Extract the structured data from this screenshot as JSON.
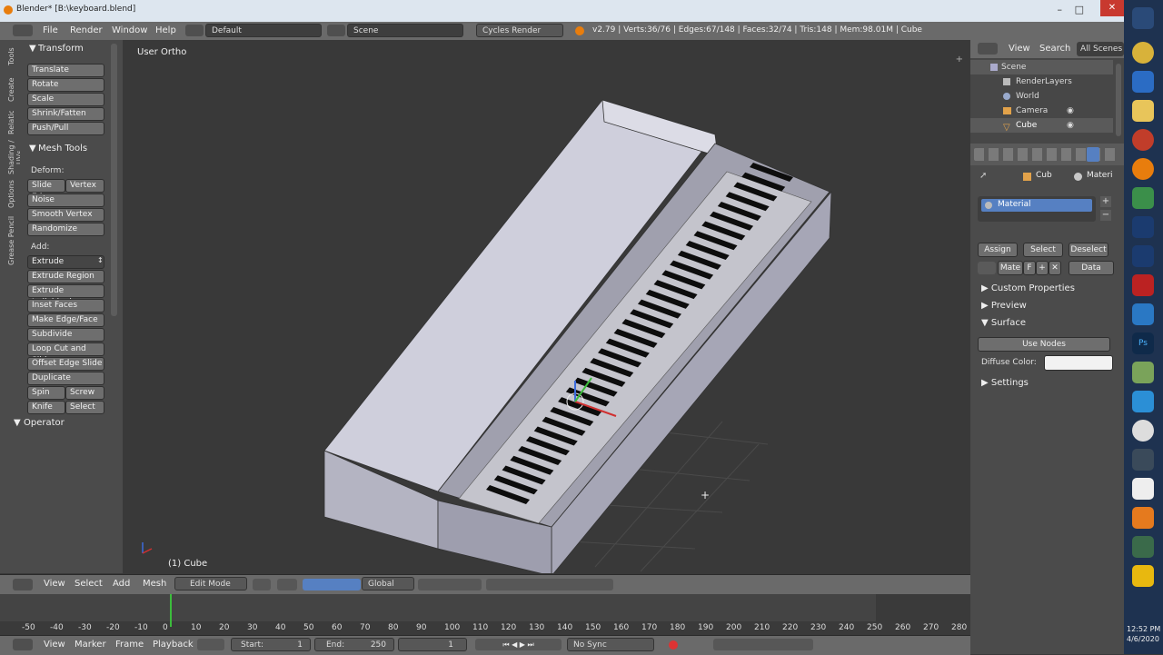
{
  "window": {
    "title": "Blender* [B:\\keyboard.blend]"
  },
  "info_header": {
    "menus": [
      "File",
      "Render",
      "Window",
      "Help"
    ],
    "layout": "Default",
    "scene": "Scene",
    "engine": "Cycles Render",
    "stats": "v2.79 | Verts:36/76 | Edges:67/148 | Faces:32/74 | Tris:148 | Mem:98.01M | Cube"
  },
  "tool_tabs": [
    "Tools",
    "Create",
    "Relations",
    "Shading / UVs",
    "Options",
    "Grease Pencil"
  ],
  "toolshelf": {
    "transform_header": "Transform",
    "transform": [
      "Translate",
      "Rotate",
      "Scale",
      "Shrink/Fatten",
      "Push/Pull"
    ],
    "mesh_tools_header": "Mesh Tools",
    "deform_label": "Deform:",
    "slide_edge": "Slide Ed",
    "vertex": "Vertex",
    "noise": "Noise",
    "smooth_vertex": "Smooth Vertex",
    "randomize": "Randomize",
    "add_label": "Add:",
    "extrude": "Extrude",
    "extrude_region": "Extrude Region",
    "extrude_individual": "Extrude Individual",
    "inset_faces": "Inset Faces",
    "make_edge_face": "Make Edge/Face",
    "subdivide": "Subdivide",
    "loop_cut": "Loop Cut and Slide",
    "offset_edge": "Offset Edge Slide",
    "duplicate": "Duplicate",
    "spin": "Spin",
    "screw": "Screw",
    "knife": "Knife",
    "select": "Select",
    "operator_header": "Operator"
  },
  "viewport": {
    "view_name": "User Ortho",
    "object_label": "(1) Cube"
  },
  "viewport_header": {
    "view": "View",
    "select": "Select",
    "add": "Add",
    "mesh": "Mesh",
    "mode": "Edit Mode",
    "orientation": "Global"
  },
  "timeline": {
    "ticks": [
      "-50",
      "-40",
      "-30",
      "-20",
      "-10",
      "0",
      "10",
      "20",
      "30",
      "40",
      "50",
      "60",
      "70",
      "80",
      "90",
      "100",
      "110",
      "120",
      "130",
      "140",
      "150",
      "160",
      "170",
      "180",
      "190",
      "200",
      "210",
      "220",
      "230",
      "240",
      "250",
      "260",
      "270",
      "280"
    ],
    "menus": [
      "View",
      "Marker",
      "Frame",
      "Playback"
    ],
    "start_label": "Start:",
    "start": "1",
    "end_label": "End:",
    "end": "250",
    "current": "1",
    "sync": "No Sync"
  },
  "outliner": {
    "view": "View",
    "search": "Search",
    "scenes": "All Scenes",
    "items": [
      "Scene",
      "RenderLayers",
      "World",
      "Camera",
      "Cube"
    ]
  },
  "properties": {
    "crumb_obj": "Cub",
    "crumb_mat": "Materi",
    "material_slot": "Material",
    "assign": "Assign",
    "select": "Select",
    "deselect": "Deselect",
    "mat_name": "Mate",
    "fake_user": "F",
    "data": "Data",
    "custom_props": "Custom Properties",
    "preview": "Preview",
    "surface": "Surface",
    "use_nodes": "Use Nodes",
    "diffuse": "Diffuse Color:",
    "settings": "Settings"
  },
  "taskbar": {
    "time": "12:52 PM",
    "date": "4/6/2020"
  },
  "colors": {
    "selection": "#5680c2",
    "header": "#6a6a6a",
    "panel": "#4b4b4b",
    "viewport": "#393939"
  }
}
